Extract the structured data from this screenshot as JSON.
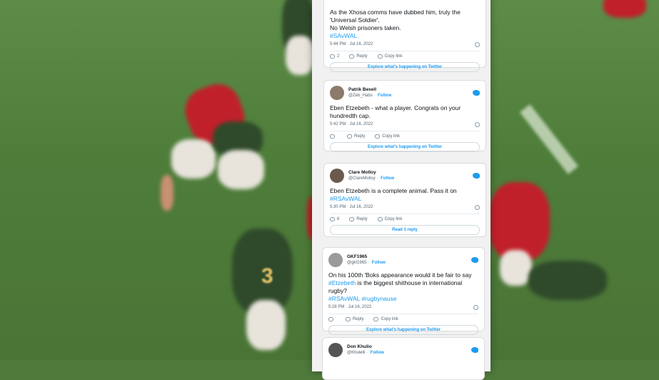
{
  "background": {
    "jersey_number": "3"
  },
  "tweets": [
    {
      "body_lines": [
        "As the Xhosa comms have dubbed him, truly the 'Universal Soldier'.",
        "No Welsh prisoners taken."
      ],
      "hashtags": [
        "#SAvWAL"
      ],
      "time": "5:44 PM · Jul 16, 2022",
      "likes": "2",
      "reply_label": "Reply",
      "copy_label": "Copy link",
      "cta": "Explore what's happening on Twitter"
    },
    {
      "name": "Patrik Bexell",
      "handle": "@Zeb_Habs",
      "follow": "Follow",
      "body_lines": [
        "Eben Etzebeth - what a player. Congrats on your hundredth cap."
      ],
      "time": "5:42 PM · Jul 16, 2022",
      "likes": "",
      "reply_label": "Reply",
      "copy_label": "Copy link",
      "cta": "Explore what's happening on Twitter"
    },
    {
      "name": "Clare Molloy",
      "handle": "@ClareMolloy",
      "follow": "Follow",
      "body_lines": [
        "Eben Etzebeth is a complete animal. Pass it on"
      ],
      "hashtags": [
        "#RSAvWAL"
      ],
      "time": "5:30 PM · Jul 16, 2022",
      "likes": "6",
      "reply_label": "Reply",
      "copy_label": "Copy link",
      "cta": "Read 1 reply"
    },
    {
      "name": "GKF1965",
      "handle": "@gkf1965",
      "follow": "Follow",
      "body_lines": [
        "On his 100th 'Boks appearance would it be fair to say"
      ],
      "inline_tag": "#Etzebeth",
      "inline_rest": "is the biggest shithouse in international rugby?",
      "hashtags": [
        "#RSAvWAL #rugbynause"
      ],
      "time": "5:28 PM · Jul 16, 2022",
      "likes": "",
      "reply_label": "Reply",
      "copy_label": "Copy link",
      "cta": "Explore what's happening on Twitter"
    },
    {
      "name": "Don Khulio",
      "handle": "@Khulelli",
      "follow": "Follow"
    }
  ]
}
